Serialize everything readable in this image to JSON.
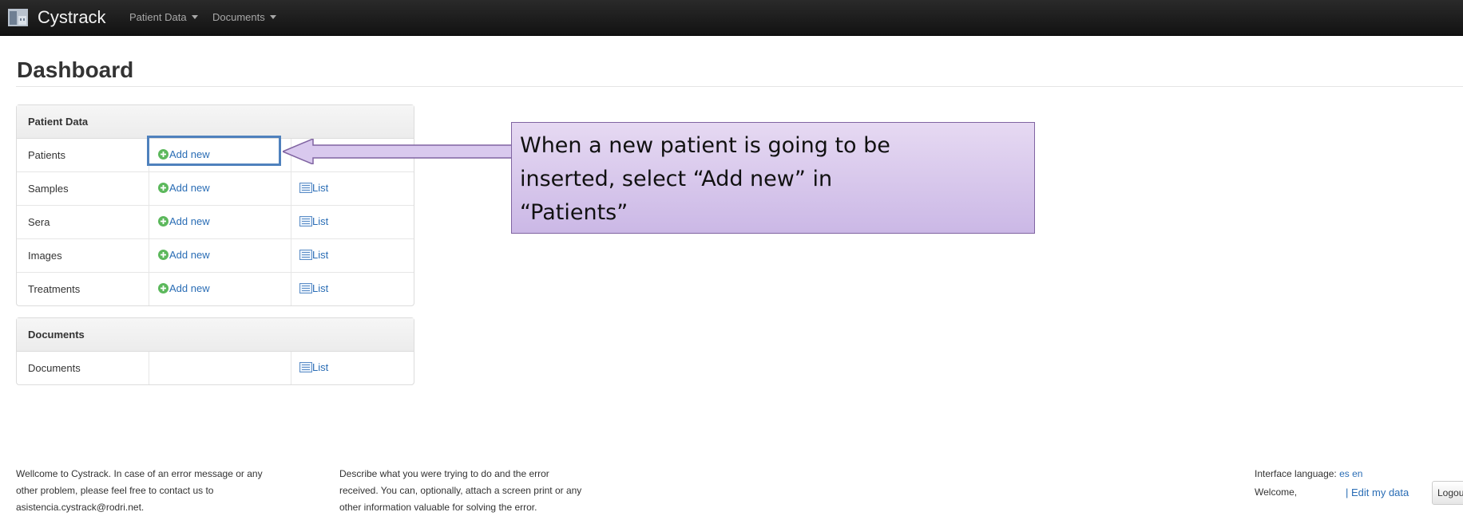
{
  "navbar": {
    "brand": "Cystrack",
    "menus": [
      "Patient Data",
      "Documents"
    ]
  },
  "page": {
    "title": "Dashboard"
  },
  "patient_panel": {
    "header": "Patient Data",
    "rows": [
      {
        "label": "Patients",
        "add": "Add new",
        "list": ""
      },
      {
        "label": "Samples",
        "add": "Add new",
        "list": "List"
      },
      {
        "label": "Sera",
        "add": "Add new",
        "list": "List"
      },
      {
        "label": "Images",
        "add": "Add new",
        "list": "List"
      },
      {
        "label": "Treatments",
        "add": "Add new",
        "list": "List"
      }
    ]
  },
  "documents_panel": {
    "header": "Documents",
    "rows": [
      {
        "label": "Documents",
        "add": "",
        "list": "List"
      }
    ]
  },
  "callout": {
    "lines": [
      "When a new patient is going to be",
      "inserted, select “Add new” in",
      "“Patients”"
    ]
  },
  "footer": {
    "contact_lines": [
      "Wellcome to Cystrack. In case of an error message or any",
      "other problem, please feel free to contact us to",
      "asistencia.cystrack@rodri.net."
    ],
    "describe_lines": [
      "Describe what you were trying to do and the error",
      "received. You can, optionally, attach a screen print or any",
      "other information valuable for solving the error."
    ],
    "language_label": "Interface language:",
    "languages": [
      "es",
      "en"
    ],
    "welcome": "Welcome,",
    "edit_link": "| Edit my data",
    "logout": "Logout"
  },
  "colors": {
    "navbar": "#1b1b1b",
    "link": "#2a6db5",
    "highlight": "#4f81bd",
    "callout_fill": "#d9c9ee",
    "callout_border": "#8064a2"
  }
}
